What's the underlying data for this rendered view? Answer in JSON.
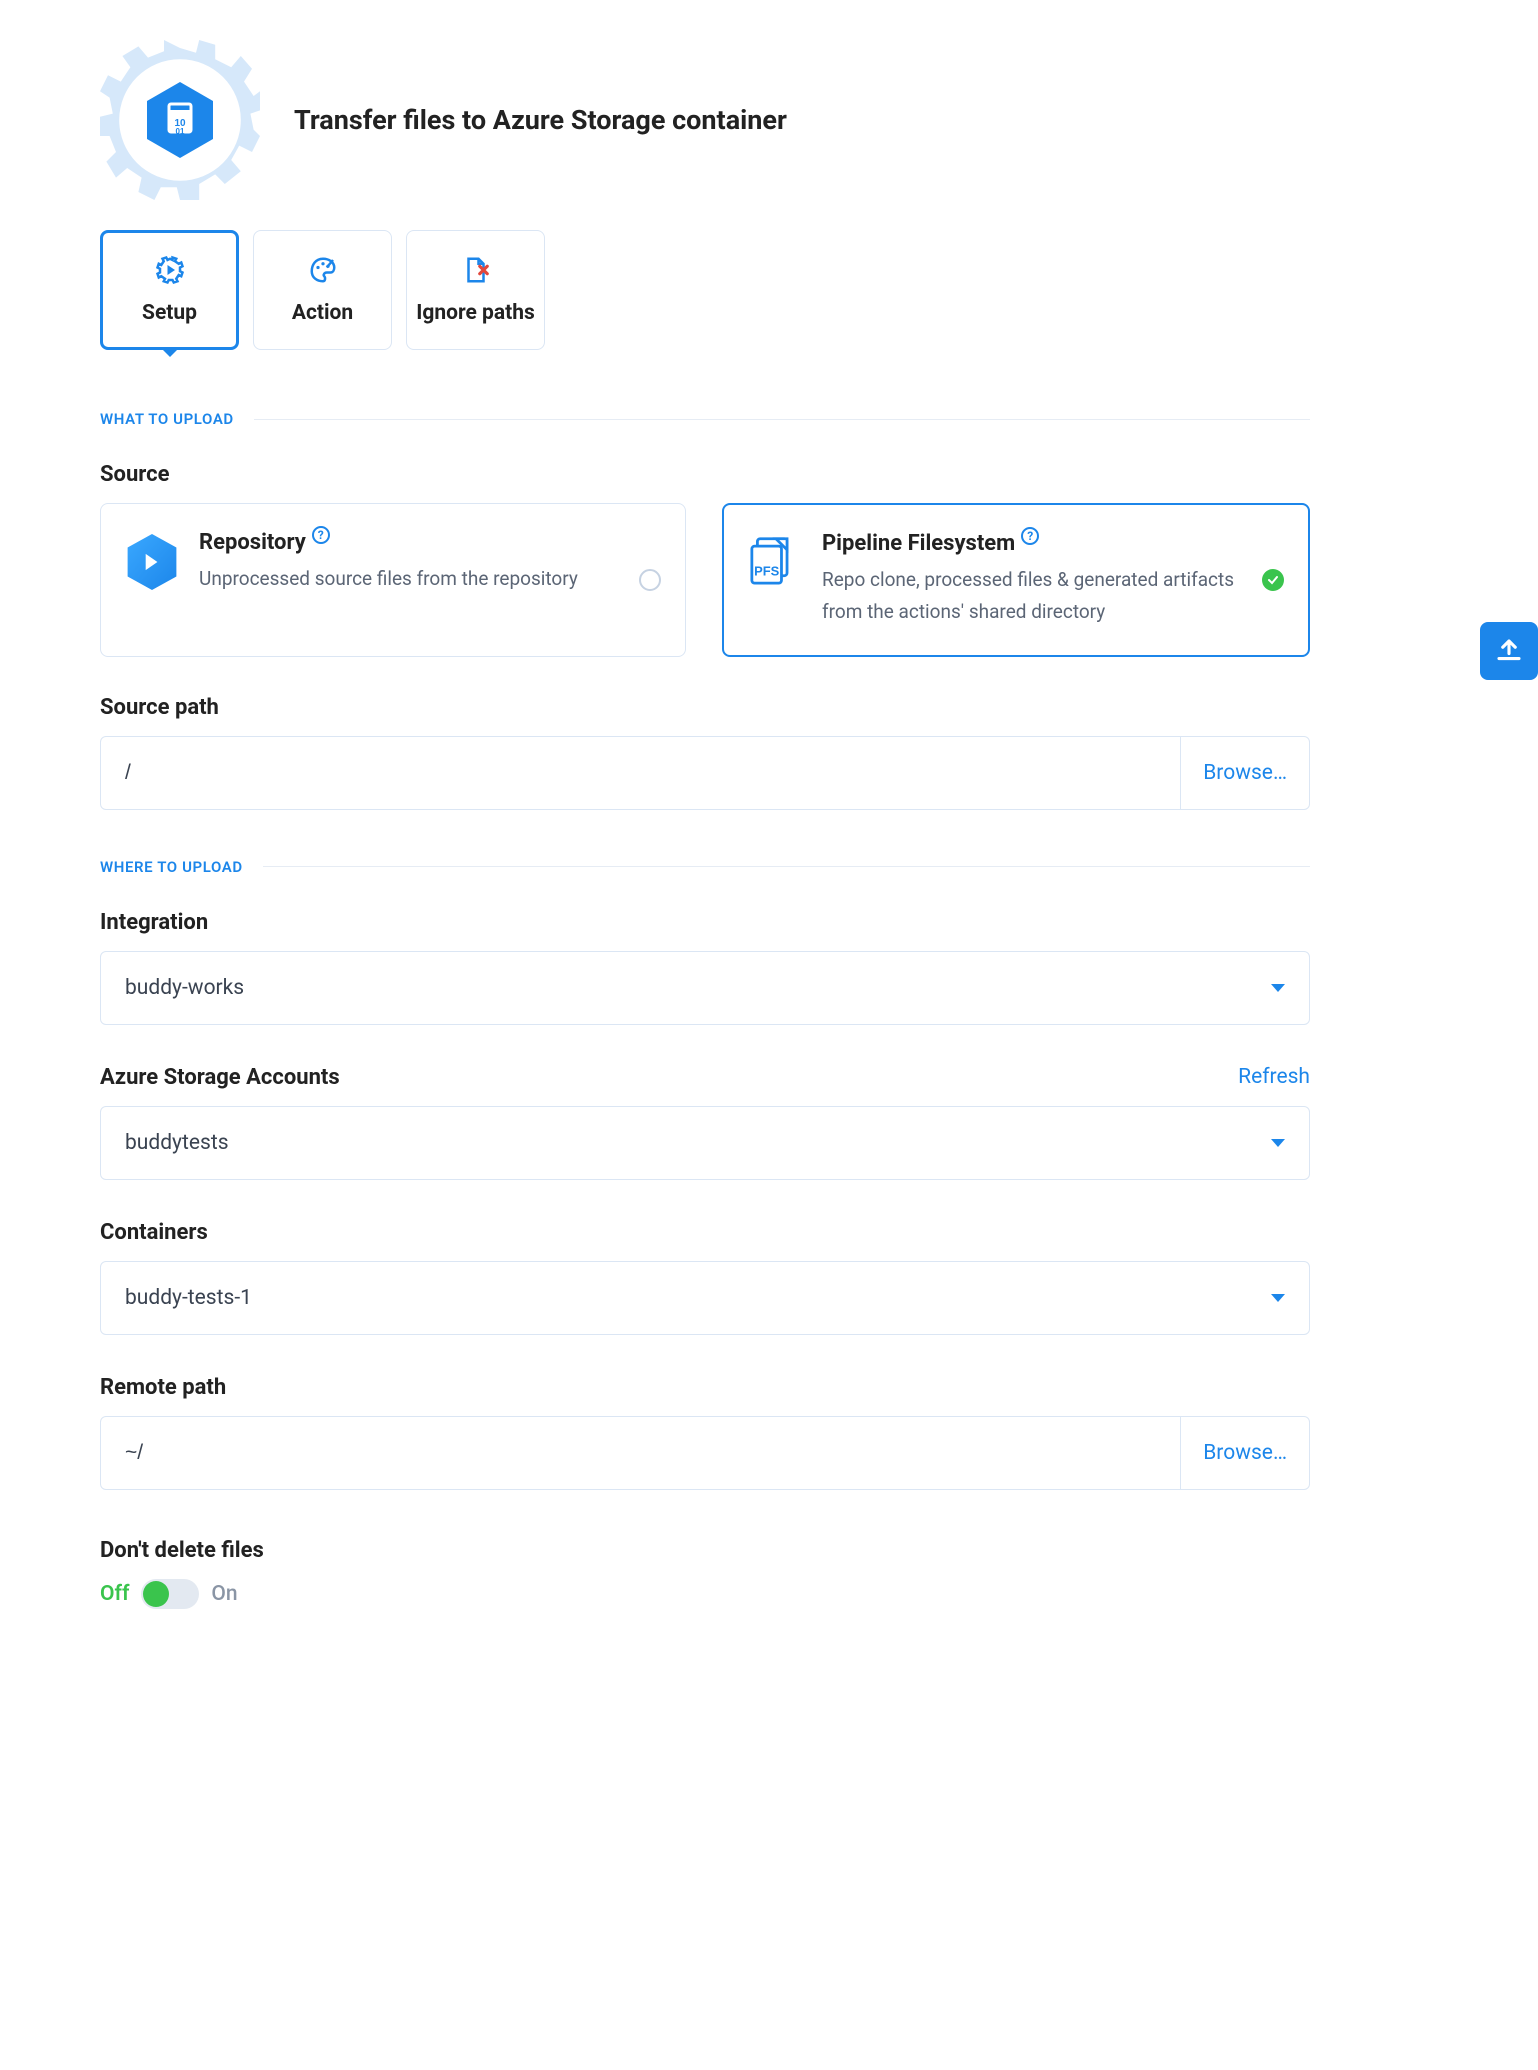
{
  "header": {
    "title": "Transfer files to Azure Storage container"
  },
  "tabs": [
    {
      "label": "Setup",
      "active": true
    },
    {
      "label": "Action",
      "active": false
    },
    {
      "label": "Ignore paths",
      "active": false
    }
  ],
  "sections": {
    "what_to_upload": "WHAT TO UPLOAD",
    "where_to_upload": "WHERE TO UPLOAD"
  },
  "source": {
    "label": "Source",
    "options": {
      "repository": {
        "title": "Repository",
        "desc": "Unprocessed source files from the repository",
        "selected": false
      },
      "pipeline": {
        "title": "Pipeline Filesystem",
        "desc": "Repo clone, processed files & generated artifacts from the actions' shared directory",
        "selected": true
      }
    }
  },
  "source_path": {
    "label": "Source path",
    "value": "/",
    "browse": "Browse…"
  },
  "integration": {
    "label": "Integration",
    "value": "buddy-works"
  },
  "storage_accounts": {
    "label": "Azure Storage Accounts",
    "refresh": "Refresh",
    "value": "buddytests"
  },
  "containers": {
    "label": "Containers",
    "value": "buddy-tests-1"
  },
  "remote_path": {
    "label": "Remote path",
    "value": "~/",
    "browse": "Browse…"
  },
  "dont_delete": {
    "label": "Don't delete files",
    "off_label": "Off",
    "on_label": "On",
    "value": "off"
  }
}
